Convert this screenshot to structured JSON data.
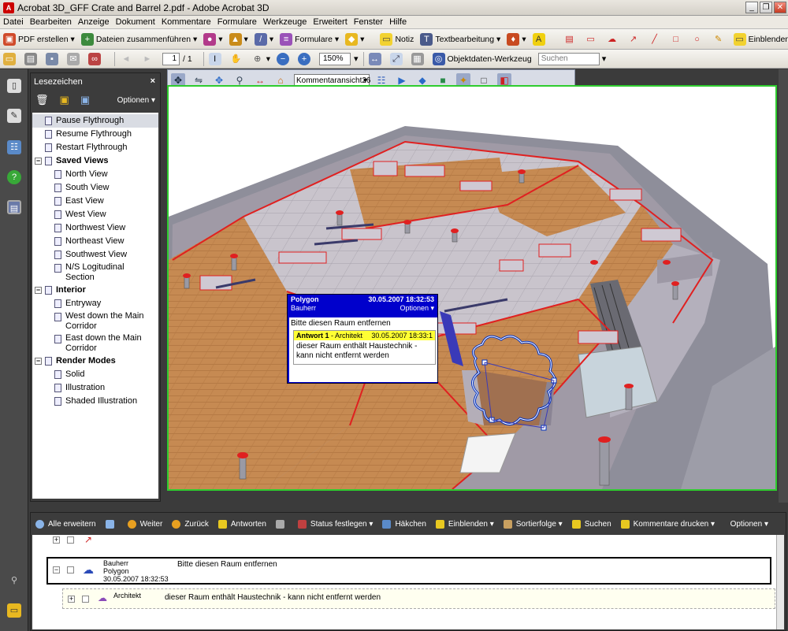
{
  "window": {
    "title": "Acrobat 3D_GFF Crate and Barrel 2.pdf - Adobe Acrobat 3D",
    "min": "_",
    "max": "❐",
    "close": "✕"
  },
  "menu": [
    "Datei",
    "Bearbeiten",
    "Anzeige",
    "Dokument",
    "Kommentare",
    "Formulare",
    "Werkzeuge",
    "Erweitert",
    "Fenster",
    "Hilfe"
  ],
  "toolbar1": {
    "pdf_create": "PDF erstellen",
    "combine": "Dateien zusammenführen",
    "forms": "Formulare",
    "note": "Notiz",
    "text_edit": "Textbearbeitung",
    "show": "Einblenden"
  },
  "toolbar2": {
    "page_current": "1",
    "page_total": "/ 1",
    "zoom": "150%",
    "object_tool": "Objektdaten-Werkzeug",
    "search_placeholder": "Suchen"
  },
  "bookmarks": {
    "title": "Lesezeichen",
    "close": "×",
    "options": "Optionen",
    "items": [
      {
        "label": "Pause Flythrough",
        "level": 1,
        "selected": true
      },
      {
        "label": "Resume Flythrough",
        "level": 1
      },
      {
        "label": "Restart Flythrough",
        "level": 1
      },
      {
        "label": "Saved Views",
        "level": 0,
        "toggle": "−"
      },
      {
        "label": "North View",
        "level": 2
      },
      {
        "label": "South View",
        "level": 2
      },
      {
        "label": "East View",
        "level": 2
      },
      {
        "label": "West View",
        "level": 2
      },
      {
        "label": "Northwest View",
        "level": 2
      },
      {
        "label": "Northeast View",
        "level": 2
      },
      {
        "label": "Southwest View",
        "level": 2
      },
      {
        "label": "N/S Logitudinal\nSection",
        "level": 2
      },
      {
        "label": "Interior",
        "level": 0,
        "toggle": "−"
      },
      {
        "label": "Entryway",
        "level": 2
      },
      {
        "label": "West down the Main\nCorridor",
        "level": 2
      },
      {
        "label": "East down the Main\nCorridor",
        "level": 2
      },
      {
        "label": "Render Modes",
        "level": 0,
        "toggle": "−"
      },
      {
        "label": "Solid",
        "level": 2
      },
      {
        "label": "Illustration",
        "level": 2
      },
      {
        "label": "Shaded Illustration",
        "level": 2
      }
    ]
  },
  "viewer": {
    "view_select": "Kommentaransicht26"
  },
  "note_popup": {
    "type": "Polygon",
    "date": "30.05.2007 18:32:53",
    "author": "Bauherr",
    "options": "Optionen",
    "text": "Bitte diesen Raum entfernen",
    "reply": {
      "header": "Antwort 1",
      "author": "- Architekt",
      "date": "30.05.2007 18:33:1",
      "text": "dieser Raum enthält Haustechnik - kann nicht entfernt werden"
    }
  },
  "comments": {
    "toolbar": {
      "expand_all": "Alle erweitern",
      "next": "Weiter",
      "back": "Zurück",
      "reply": "Antworten",
      "status": "Status festlegen",
      "checkmark": "Häkchen",
      "show": "Einblenden",
      "sort": "Sortierfolge",
      "search": "Suchen",
      "print": "Kommentare drucken",
      "options": "Optionen"
    },
    "rows": [
      {
        "author": "Bauherr",
        "type": "Polygon",
        "date": "30.05.2007 18:32:53",
        "text": "Bitte diesen Raum entfernen"
      },
      {
        "author": "Architekt",
        "text": "dieser Raum enthält Haustechnik - kann nicht entfernt werden"
      }
    ]
  }
}
